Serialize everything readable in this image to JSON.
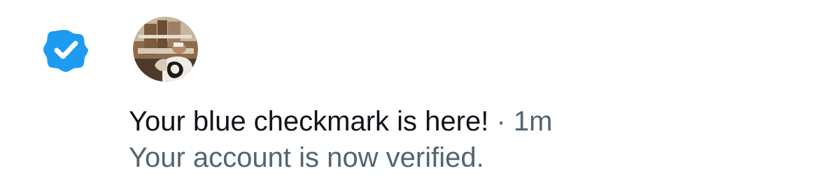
{
  "notification": {
    "icon": "verified-badge-icon",
    "badge_color": "#1d9bf0",
    "avatar": "profile-photo",
    "title": "Your blue checkmark is here!",
    "separator": "·",
    "time": "1m",
    "subtitle": "Your account is now verified."
  }
}
